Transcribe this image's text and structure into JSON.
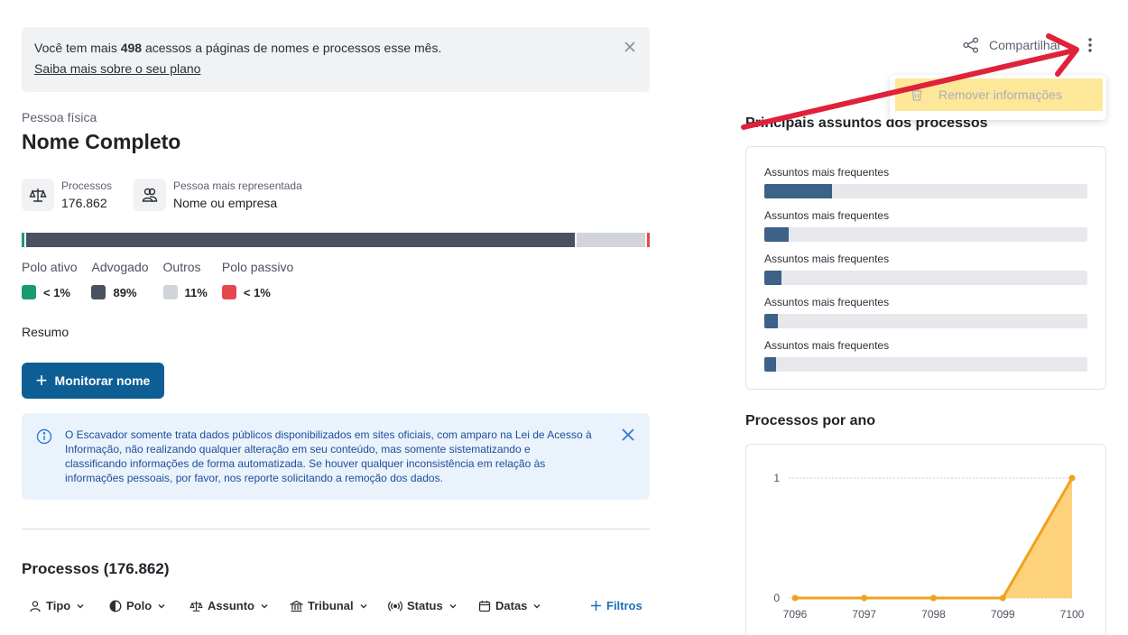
{
  "plan_banner": {
    "text_before": "Você tem mais ",
    "count": "498",
    "text_after": " acessos a páginas de nomes e processos esse mês.",
    "link": "Saiba mais sobre o seu plano"
  },
  "person": {
    "type": "Pessoa física",
    "name": "Nome Completo",
    "processes_label": "Processos",
    "processes_value": "176.862",
    "represented_label": "Pessoa mais representada",
    "represented_value": "Nome ou empresa"
  },
  "polo": {
    "segments": [
      {
        "name": "Polo ativo",
        "pct_label": "< 1%",
        "fraction": 0.005,
        "color": "#1a9b6c"
      },
      {
        "name": "Advogado",
        "pct_label": "89%",
        "fraction": 0.89,
        "color": "#4a5160"
      },
      {
        "name": "Outros",
        "pct_label": "11%",
        "fraction": 0.11,
        "color": "#d1d4da"
      },
      {
        "name": "Polo passivo",
        "pct_label": "< 1%",
        "fraction": 0.005,
        "color": "#e5484d"
      }
    ]
  },
  "resumo": "Resumo",
  "monitor_button": "Monitorar nome",
  "info_box": "O Escavador somente trata dados públicos disponibilizados em sites oficiais, com amparo na Lei de Acesso à Informação, não realizando qualquer alteração em seu conteúdo, mas somente sistematizando e classificando informações de forma automatizada. Se houver qualquer inconsistência em relação às informações pessoais, por favor, nos reporte solicitando a remoção dos dados.",
  "processes_title": "Processos (176.862)",
  "filters": [
    "Tipo",
    "Polo",
    "Assunto",
    "Tribunal",
    "Status",
    "Datas"
  ],
  "filters_more": "Filtros",
  "share": "Compartilhar",
  "menu": {
    "remove": "Remover informações"
  },
  "subjects": {
    "title": "Principais assuntos dos processos",
    "items": [
      {
        "label": "Assuntos mais frequentes",
        "fraction": 0.21
      },
      {
        "label": "Assuntos mais frequentes",
        "fraction": 0.075
      },
      {
        "label": "Assuntos mais frequentes",
        "fraction": 0.053
      },
      {
        "label": "Assuntos mais frequentes",
        "fraction": 0.042
      },
      {
        "label": "Assuntos mais frequentes",
        "fraction": 0.037
      }
    ]
  },
  "chart_data": {
    "type": "area",
    "title": "Processos por ano",
    "x": [
      "7096",
      "7097",
      "7098",
      "7099",
      "7100"
    ],
    "values": [
      0,
      0,
      0,
      0,
      1
    ],
    "y_ticks": [
      "0",
      "1"
    ],
    "ylim": [
      0,
      1
    ],
    "grid": true,
    "line_color": "#f0a11f",
    "fill_color": "#fdd27a"
  },
  "colors": {
    "accent": "#0d5e94",
    "annotation": "#e0213a"
  }
}
